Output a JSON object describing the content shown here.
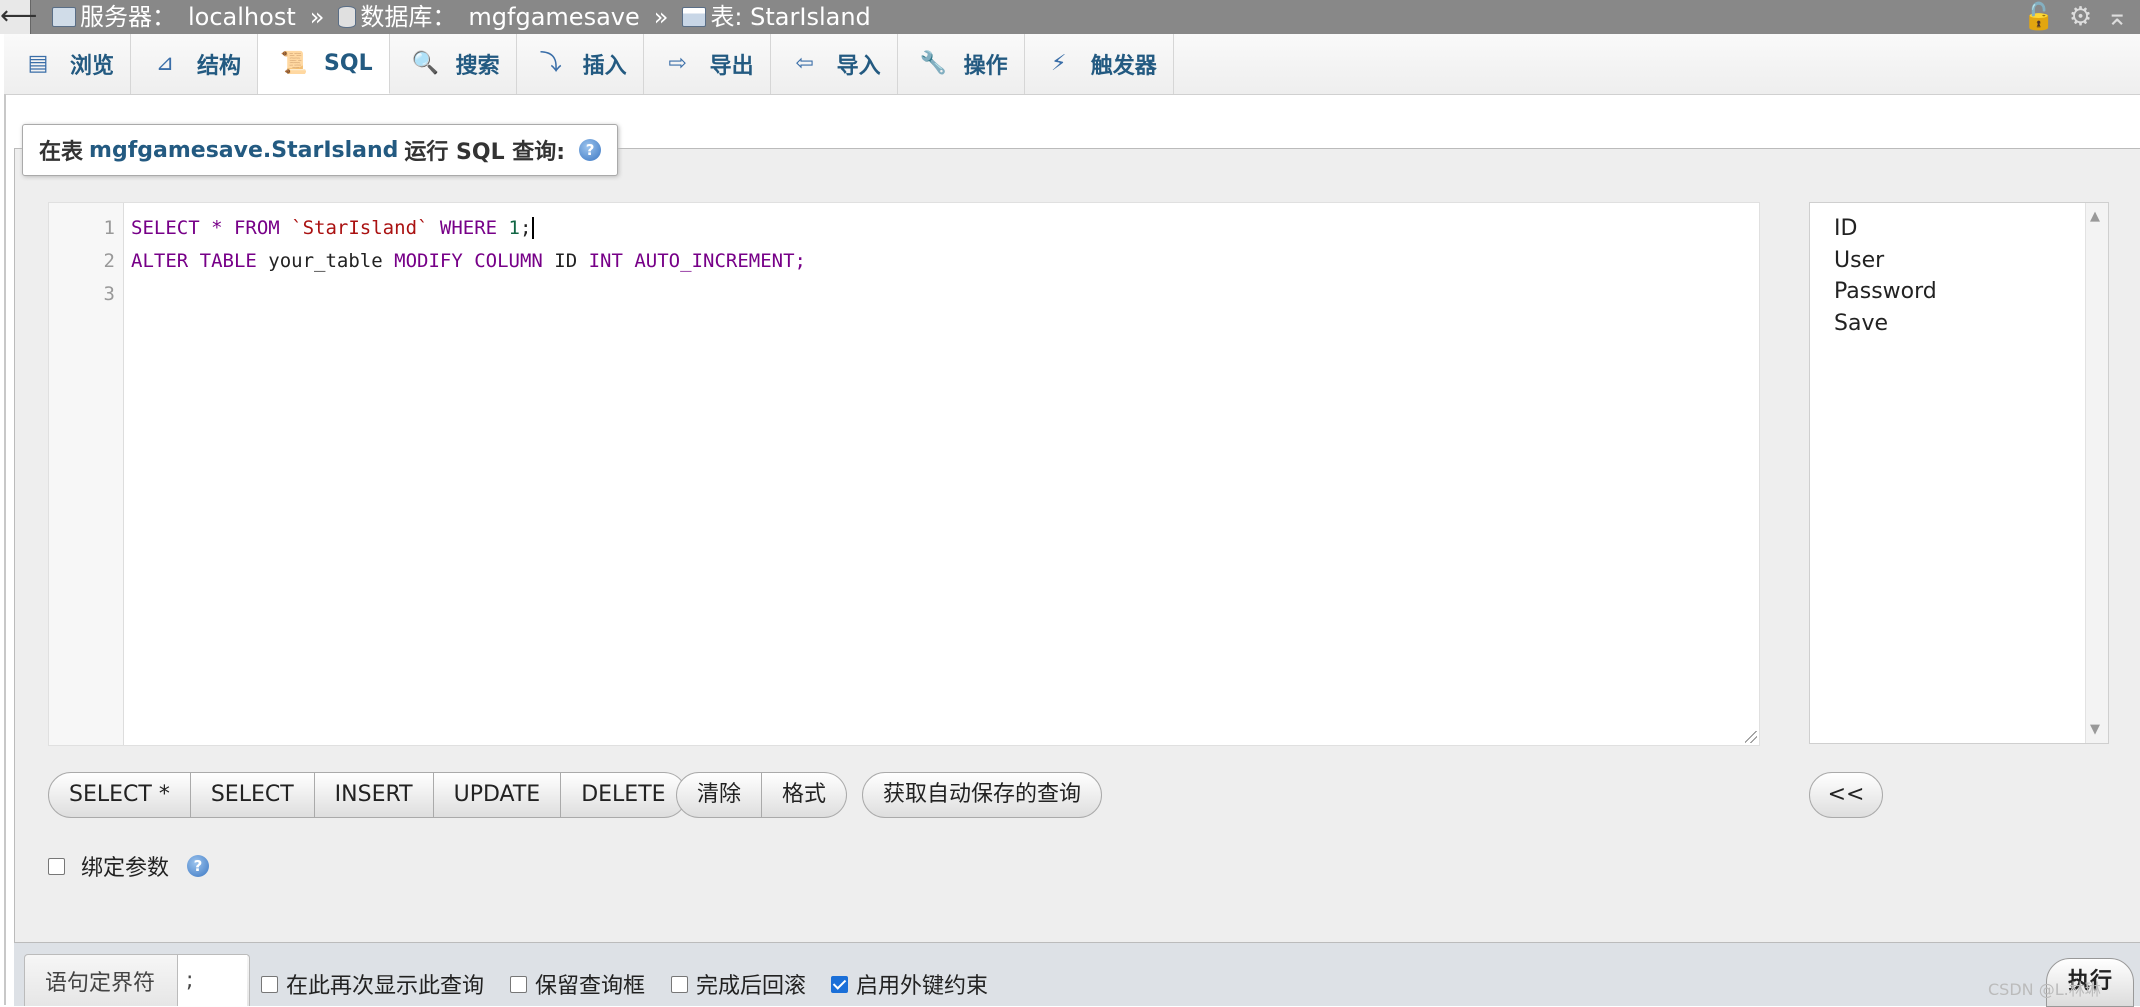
{
  "topbar": {
    "collapse": "⟵",
    "server_label": "服务器：",
    "server_value": "localhost",
    "db_label": "数据库：",
    "db_value": "mgfgamesave",
    "table_label": "表: StarIsland",
    "sep": "»"
  },
  "tabs": [
    {
      "label": "浏览",
      "icon": "browse-icon"
    },
    {
      "label": "结构",
      "icon": "structure-icon"
    },
    {
      "label": "SQL",
      "icon": "sql-icon"
    },
    {
      "label": "搜索",
      "icon": "search-icon"
    },
    {
      "label": "插入",
      "icon": "insert-icon"
    },
    {
      "label": "导出",
      "icon": "export-icon"
    },
    {
      "label": "导入",
      "icon": "import-icon"
    },
    {
      "label": "操作",
      "icon": "wrench-icon"
    },
    {
      "label": "触发器",
      "icon": "trigger-icon"
    }
  ],
  "legend": {
    "prefix": "在表",
    "table": "mgfgamesave.StarIsland",
    "suffix": "运行 SQL 查询:",
    "help": "?"
  },
  "editor": {
    "line_numbers": [
      "1",
      "2",
      "3"
    ],
    "line1": {
      "k1": "SELECT",
      "star": " * ",
      "k2": "FROM",
      "tbl": " `StarIsland` ",
      "k3": "WHERE",
      "num": " 1",
      "end": ";"
    },
    "line2": {
      "k1": "ALTER TABLE",
      "ident": " your_table ",
      "k2": "MODIFY COLUMN",
      "ident2": " ID ",
      "k3": "INT AUTO_INCREMENT;"
    }
  },
  "columns": [
    "ID",
    "User",
    "Password",
    "Save"
  ],
  "buttons": {
    "group1": [
      "SELECT *",
      "SELECT",
      "INSERT",
      "UPDATE",
      "DELETE"
    ],
    "group2": [
      "清除",
      "格式"
    ],
    "autosave": "获取自动保存的查询",
    "insert_column": "<<"
  },
  "bind_params": "绑定参数",
  "bottom": {
    "delimiter_label": "语句定界符",
    "delimiter_value": ";",
    "show_again": "在此再次显示此查询",
    "keep_box": "保留查询框",
    "rollback": "完成后回滚",
    "foreign_keys": "启用外键约束",
    "go": "执行"
  },
  "watermark": "CSDN @L.林琳"
}
